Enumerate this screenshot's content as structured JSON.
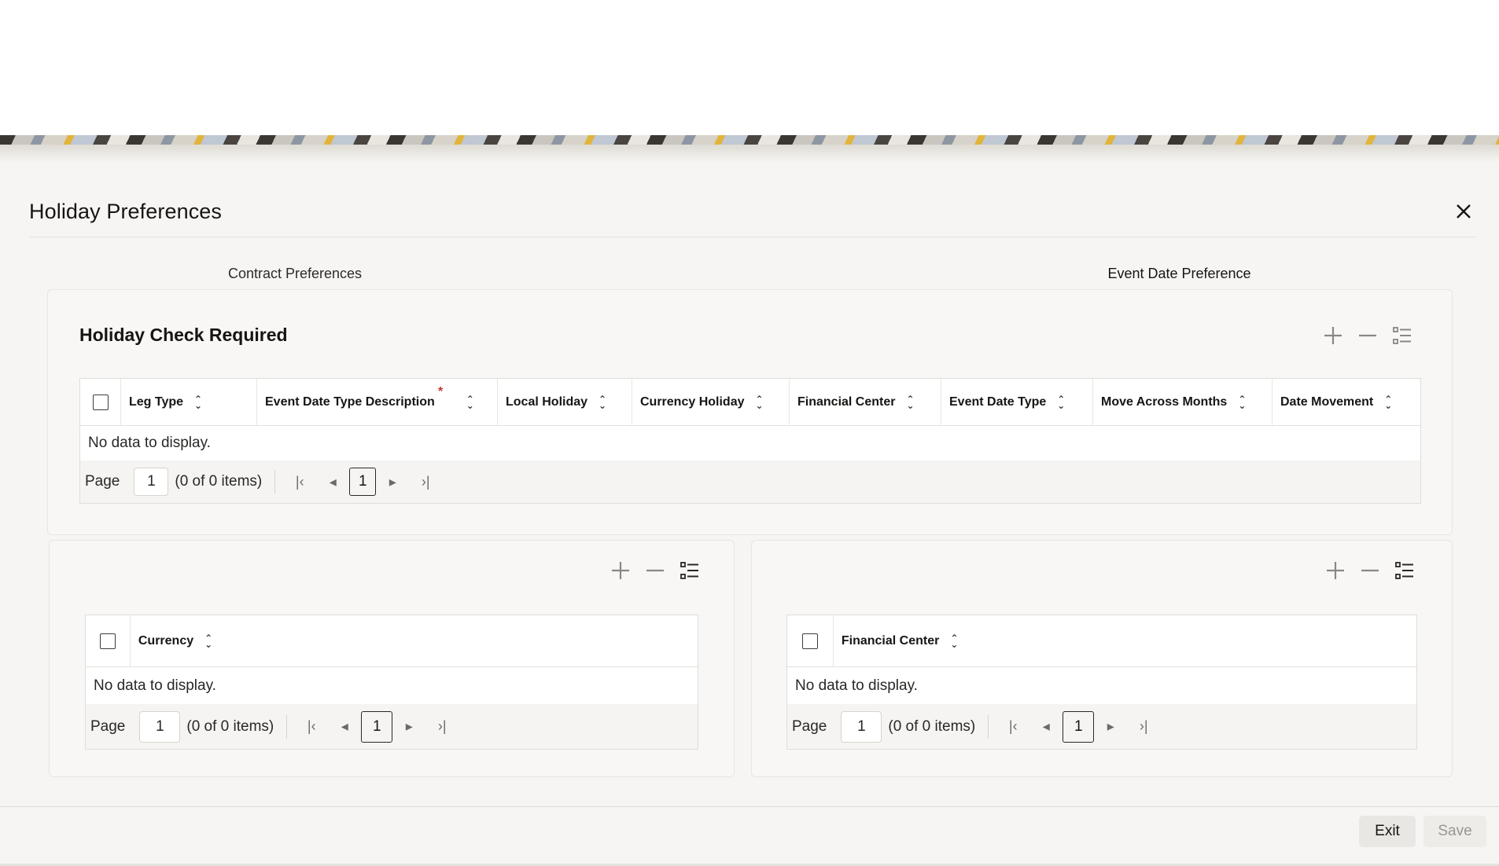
{
  "dialog": {
    "title": "Holiday Preferences",
    "close_glyph": "✕"
  },
  "tabs": [
    {
      "label": "Contract Preferences",
      "active": false
    },
    {
      "label": "Event Date Preference",
      "active": true
    }
  ],
  "holiday_check": {
    "title": "Holiday Check Required",
    "columns": [
      {
        "label": "Leg Type",
        "required": false
      },
      {
        "label": "Event Date Type Description",
        "required": true
      },
      {
        "label": "Local Holiday",
        "required": false
      },
      {
        "label": "Currency Holiday",
        "required": false
      },
      {
        "label": "Financial Center",
        "required": false
      },
      {
        "label": "Event Date Type",
        "required": false
      },
      {
        "label": "Move Across Months",
        "required": false
      },
      {
        "label": "Date Movement",
        "required": false
      }
    ],
    "required_mark": "*",
    "empty_text": "No data to display.",
    "pager": {
      "page_label": "Page",
      "page_value": "1",
      "items_text": "(0 of 0 items)",
      "current": "1"
    }
  },
  "currency_grid": {
    "columns": [
      {
        "label": "Currency"
      }
    ],
    "empty_text": "No data to display.",
    "pager": {
      "page_label": "Page",
      "page_value": "1",
      "items_text": "(0 of 0 items)",
      "current": "1"
    }
  },
  "financial_center_grid": {
    "columns": [
      {
        "label": "Financial Center"
      }
    ],
    "empty_text": "No data to display.",
    "pager": {
      "page_label": "Page",
      "page_value": "1",
      "items_text": "(0 of 0 items)",
      "current": "1"
    }
  },
  "icons": {
    "add": "plus-icon",
    "remove": "minus-icon",
    "single_record": "list-view-icon",
    "sort": "sort-icon",
    "first": "first-page-icon",
    "prev": "previous-page-icon",
    "next": "next-page-icon",
    "last": "last-page-icon"
  },
  "footer": {
    "exit_label": "Exit",
    "save_label": "Save"
  },
  "colors": {
    "accent_tab_underline": "#4b5563",
    "required_asterisk": "#c0392b"
  }
}
